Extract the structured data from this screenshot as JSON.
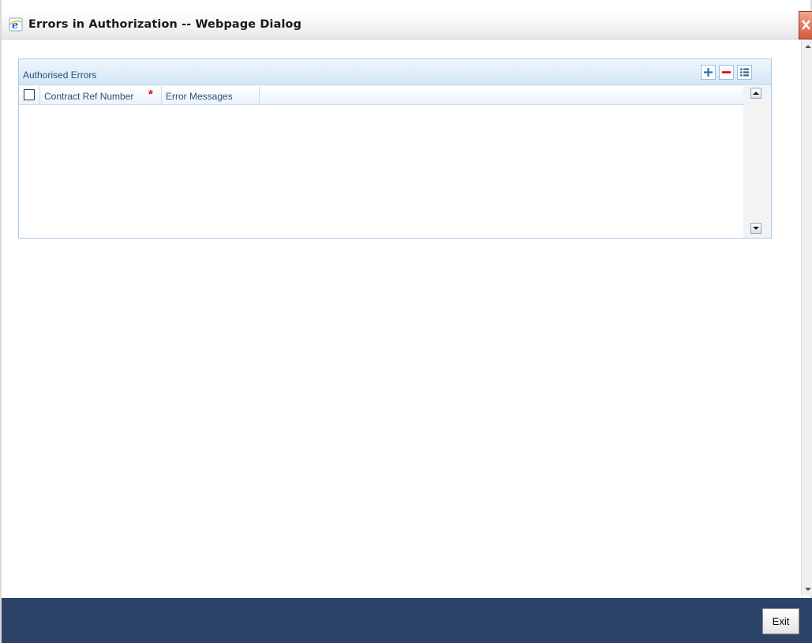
{
  "window": {
    "title": "Errors in Authorization -- Webpage Dialog"
  },
  "panel": {
    "title": "Authorised Errors",
    "toolbar": {
      "add_icon": "plus-icon",
      "remove_icon": "minus-icon",
      "view_icon": "list-icon"
    },
    "columns": [
      "Contract Ref Number",
      "Error Messages"
    ],
    "required_marker": "*",
    "rows": []
  },
  "footer": {
    "exit_label": "Exit"
  },
  "colors": {
    "footer_bg": "#2c4467",
    "panel_header": "#d3e7f8",
    "required": "#e00000"
  }
}
